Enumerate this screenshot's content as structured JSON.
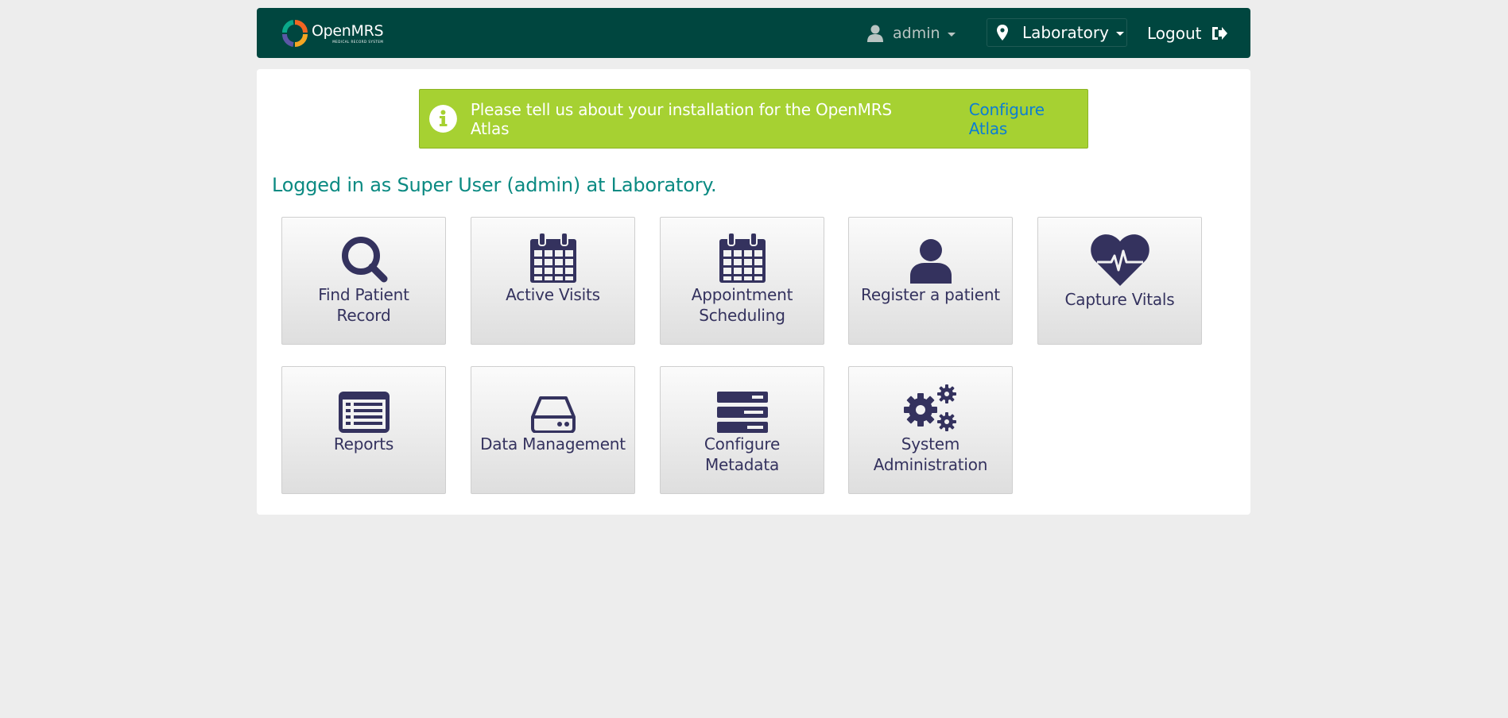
{
  "header": {
    "logo_name": "OpenMRS",
    "logo_subtitle": "Medical Record System",
    "user": "admin",
    "location": "Laboratory",
    "logout": "Logout"
  },
  "banner": {
    "message": "Please tell us about your installation for the OpenMRS Atlas",
    "link": "Configure Atlas"
  },
  "welcome": "Logged in as Super User (admin) at Laboratory.",
  "apps": [
    {
      "label": "Find Patient Record",
      "icon": "search-icon"
    },
    {
      "label": "Active Visits",
      "icon": "calendar-icon"
    },
    {
      "label": "Appointment Scheduling",
      "icon": "calendar-icon"
    },
    {
      "label": "Register a patient",
      "icon": "user-icon"
    },
    {
      "label": "Capture Vitals",
      "icon": "heartbeat-icon"
    },
    {
      "label": "Reports",
      "icon": "list-alt-icon"
    },
    {
      "label": "Data Management",
      "icon": "hdd-icon"
    },
    {
      "label": "Configure Metadata",
      "icon": "server-icon"
    },
    {
      "label": "System Administration",
      "icon": "cogs-icon"
    }
  ],
  "colors": {
    "header_bg": "#00463f",
    "banner_bg": "#a6d132",
    "welcome_text": "#0b8a82",
    "tile_text": "#34325e",
    "link": "#0b7dd4"
  }
}
